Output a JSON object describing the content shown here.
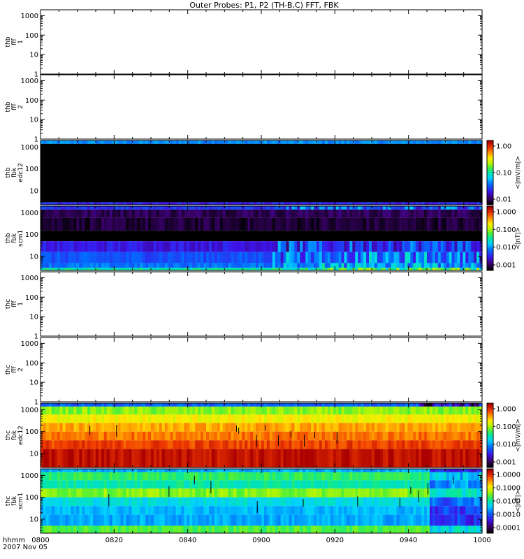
{
  "chart_data": {
    "type": "heatmap",
    "title": "Outer Probes: P1, P2 (TH-B,C) FFT, FBK",
    "x_ticks": [
      "0800",
      "0820",
      "0840",
      "0900",
      "0920",
      "0940",
      "1000"
    ],
    "x_range_minutes": [
      0,
      120
    ],
    "footer": {
      "line1": "hhmm",
      "line2": "2007 Nov 05"
    },
    "panels": [
      {
        "ylabel": [
          "thb",
          "fff",
          "1"
        ],
        "yticks": [
          "1000",
          "100",
          "10",
          "1"
        ],
        "ylim": [
          1,
          2000
        ],
        "yscale": "log",
        "has_data": false
      },
      {
        "ylabel": [
          "thb",
          "fff",
          "2"
        ],
        "yticks": [
          "1000",
          "100",
          "10",
          "1"
        ],
        "ylim": [
          1,
          2000
        ],
        "yscale": "log",
        "has_data": false
      },
      {
        "ylabel": [
          "thb",
          "fbk",
          "edc12"
        ],
        "yticks": [
          "1000",
          "100",
          "10"
        ],
        "ylim": [
          2.3,
          2000
        ],
        "yscale": "log",
        "has_data": true,
        "colorbar": {
          "label": "<|mV/m|>",
          "ticks": [
            "1.00",
            "0.10",
            "0.01"
          ],
          "scale": "log"
        }
      },
      {
        "ylabel": [
          "thb",
          "fbk",
          "scm1"
        ],
        "yticks": [
          "1000",
          "100",
          "10"
        ],
        "ylim": [
          2.3,
          2000
        ],
        "yscale": "log",
        "has_data": true,
        "colorbar": {
          "label": "<|nT|>",
          "ticks": [
            "1.000",
            "0.100",
            "0.010",
            "0.001"
          ],
          "scale": "log"
        }
      },
      {
        "ylabel": [
          "thc",
          "fff",
          "1"
        ],
        "yticks": [
          "1000",
          "100",
          "10",
          "1"
        ],
        "ylim": [
          1,
          2000
        ],
        "yscale": "log",
        "has_data": false
      },
      {
        "ylabel": [
          "thc",
          "fff",
          "2"
        ],
        "yticks": [
          "1000",
          "100",
          "10",
          "1"
        ],
        "ylim": [
          1,
          2000
        ],
        "yscale": "log",
        "has_data": false
      },
      {
        "ylabel": [
          "thc",
          "fbk",
          "edc12"
        ],
        "yticks": [
          "1000",
          "100",
          "10"
        ],
        "ylim": [
          2.3,
          2000
        ],
        "yscale": "log",
        "has_data": true,
        "colorbar": {
          "label": "<|mV/m|>",
          "ticks": [
            "1.000",
            "0.100",
            "0.010",
            "0.001"
          ],
          "scale": "log"
        }
      },
      {
        "ylabel": [
          "thc",
          "fbk",
          "scm1"
        ],
        "yticks": [
          "1000",
          "100",
          "10"
        ],
        "ylim": [
          2.3,
          2000
        ],
        "yscale": "log",
        "has_data": true,
        "colorbar": {
          "label": "<|nT|>",
          "ticks": [
            "1.0000",
            "0.1000",
            "0.0100",
            "0.0010",
            "0.0001"
          ],
          "scale": "log"
        }
      }
    ],
    "heatmap_bands": {
      "thb_edc12": [
        {
          "band": "1400-2000",
          "level": 0.35
        },
        {
          "band": "3-1400",
          "level": 0.0
        },
        {
          "band": "2.3-3",
          "level": 0.22
        }
      ],
      "thb_scm1": [
        {
          "band": "1400-2000",
          "level": 0.25
        },
        {
          "band": "600-1400",
          "level": 0.08
        },
        {
          "band": "150-600",
          "level": 0.05
        },
        {
          "band": "50-150",
          "level": 0.0
        },
        {
          "band": "16-50",
          "level": 0.2
        },
        {
          "band": "5-16",
          "level": 0.28
        },
        {
          "band": "3-5",
          "level": 0.32
        },
        {
          "band": "2.3-3",
          "level": 0.5
        }
      ],
      "thc_edc12": [
        {
          "band": "1400-2000",
          "level": 0.3
        },
        {
          "band": "600-1400",
          "level": 0.62
        },
        {
          "band": "250-600",
          "level": 0.72
        },
        {
          "band": "100-250",
          "level": 0.8
        },
        {
          "band": "40-100",
          "level": 0.85
        },
        {
          "band": "16-40",
          "level": 0.9
        },
        {
          "band": "2.3-16",
          "level": 0.97
        }
      ],
      "thc_scm1": [
        {
          "band": "1400-2000",
          "level": 0.38
        },
        {
          "band": "600-1400",
          "level": 0.55
        },
        {
          "band": "250-600",
          "level": 0.5
        },
        {
          "band": "100-250",
          "level": 0.62
        },
        {
          "band": "40-100",
          "level": 0.45
        },
        {
          "band": "16-40",
          "level": 0.4
        },
        {
          "band": "5-16",
          "level": 0.38
        },
        {
          "band": "2.3-5",
          "level": 0.58
        }
      ]
    }
  }
}
